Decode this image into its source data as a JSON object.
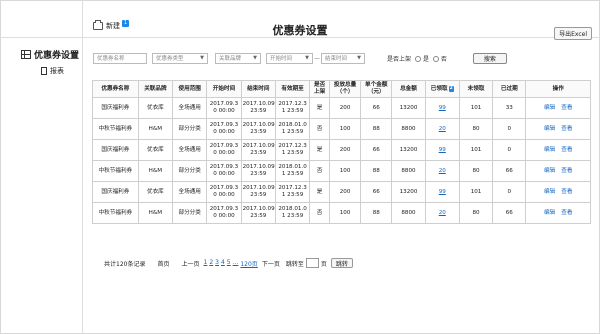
{
  "header": {
    "new_label": "新建",
    "new_badge": "1",
    "title": "优惠券设置",
    "export_label": "导出Excel"
  },
  "sidebar": {
    "title": "优惠券设置",
    "items": [
      {
        "label": "报表"
      }
    ]
  },
  "filters": {
    "name_placeholder": "优惠券名称",
    "type_placeholder": "优惠券类型",
    "brand_placeholder": "关联品牌",
    "start_placeholder": "开始时间",
    "end_placeholder": "结束时间",
    "range_dash": "—",
    "online_label": "是否上架",
    "yes_label": "是",
    "no_label": "否",
    "search_label": "搜索"
  },
  "table": {
    "headers": [
      "优惠券名称",
      "关联品牌",
      "使用范围",
      "开始时间",
      "结束时间",
      "有效期至",
      "是否上架",
      "投放总量（个）",
      "单个金额（元）",
      "总金额",
      "已领取",
      "未领取",
      "已过期",
      "操作"
    ],
    "claimed_badge": "2",
    "rows": [
      {
        "name": "国庆福利券",
        "brand": "优衣库",
        "scope": "全场通用",
        "start": "2017.09.3 0 00:00",
        "end": "2017.10.09 23:59",
        "valid": "2017.12.3 1 23:59",
        "online": "是",
        "total": "200",
        "amount": "66",
        "sum": "13200",
        "claimed": "99",
        "unclaimed": "101",
        "expired": "33"
      },
      {
        "name": "中秋节福利券",
        "brand": "H&M",
        "scope": "部分分类",
        "start": "2017.09.3 0 00:00",
        "end": "2017.10.09 23:59",
        "valid": "2018.01.0 1 23:59",
        "online": "否",
        "total": "100",
        "amount": "88",
        "sum": "8800",
        "claimed": "20",
        "unclaimed": "80",
        "expired": "0"
      },
      {
        "name": "国庆福利券",
        "brand": "优衣库",
        "scope": "全场通用",
        "start": "2017.09.3 0 00:00",
        "end": "2017.10.09 23:59",
        "valid": "2017.12.3 1 23:59",
        "online": "是",
        "total": "200",
        "amount": "66",
        "sum": "13200",
        "claimed": "99",
        "unclaimed": "101",
        "expired": "0"
      },
      {
        "name": "中秋节福利券",
        "brand": "H&M",
        "scope": "部分分类",
        "start": "2017.09.3 0 00:00",
        "end": "2017.10.09 23:59",
        "valid": "2018.01.0 1 23:59",
        "online": "否",
        "total": "100",
        "amount": "88",
        "sum": "8800",
        "claimed": "20",
        "unclaimed": "80",
        "expired": "66"
      },
      {
        "name": "国庆福利券",
        "brand": "优衣库",
        "scope": "全场通用",
        "start": "2017.09.3 0 00:00",
        "end": "2017.10.09 23:59",
        "valid": "2017.12.3 1 23:59",
        "online": "是",
        "total": "200",
        "amount": "66",
        "sum": "13200",
        "claimed": "99",
        "unclaimed": "101",
        "expired": "0"
      },
      {
        "name": "中秋节福利券",
        "brand": "H&M",
        "scope": "部分分类",
        "start": "2017.09.3 0 00:00",
        "end": "2017.10.09 23:59",
        "valid": "2018.01.0 1 23:59",
        "online": "否",
        "total": "100",
        "amount": "88",
        "sum": "8800",
        "claimed": "20",
        "unclaimed": "80",
        "expired": "66"
      }
    ],
    "edit_label": "编辑",
    "view_label": "查看"
  },
  "pagination": {
    "total": "共计120条记录",
    "first": "首页",
    "prev": "上一页",
    "pages": [
      "1",
      "2",
      "3",
      "4",
      "5",
      "...",
      "120页"
    ],
    "next": "下一页",
    "jump_label": "跳转至",
    "page_unit": "页",
    "go_label": "跳转"
  }
}
